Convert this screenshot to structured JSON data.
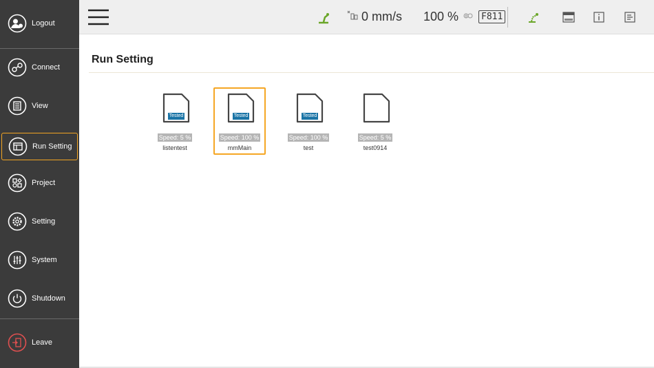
{
  "sidebar": {
    "items": [
      {
        "label": "Logout",
        "icon": "user-icon"
      },
      {
        "label": "Connect",
        "icon": "connect-icon"
      },
      {
        "label": "View",
        "icon": "view-icon"
      },
      {
        "label": "Run Setting",
        "icon": "run-setting-icon",
        "active": true
      },
      {
        "label": "Project",
        "icon": "project-icon"
      },
      {
        "label": "Setting",
        "icon": "gear-icon"
      },
      {
        "label": "System",
        "icon": "sliders-icon"
      },
      {
        "label": "Shutdown",
        "icon": "power-icon"
      },
      {
        "label": "Leave",
        "icon": "exit-door-icon"
      }
    ]
  },
  "topbar": {
    "speed": "0 mm/s",
    "percent": "100 %",
    "badge": "F811"
  },
  "page": {
    "title": "Run Setting"
  },
  "files": [
    {
      "name": "listentest",
      "speed": "Speed: 5 %",
      "tested": "Tested",
      "selected": false
    },
    {
      "name": "mmMain",
      "speed": "Speed: 100 %",
      "tested": "Tested",
      "selected": true
    },
    {
      "name": "test",
      "speed": "Speed: 100 %",
      "tested": "Tested",
      "selected": false
    },
    {
      "name": "test0914",
      "speed": "Speed: 5 %",
      "tested": "",
      "selected": false
    }
  ],
  "colors": {
    "sidebar_bg": "#3b3b3b",
    "accent": "#f5a623",
    "tested_tag": "#1a74a6",
    "status_green": "#6aa628",
    "leave_red": "#e05050"
  }
}
